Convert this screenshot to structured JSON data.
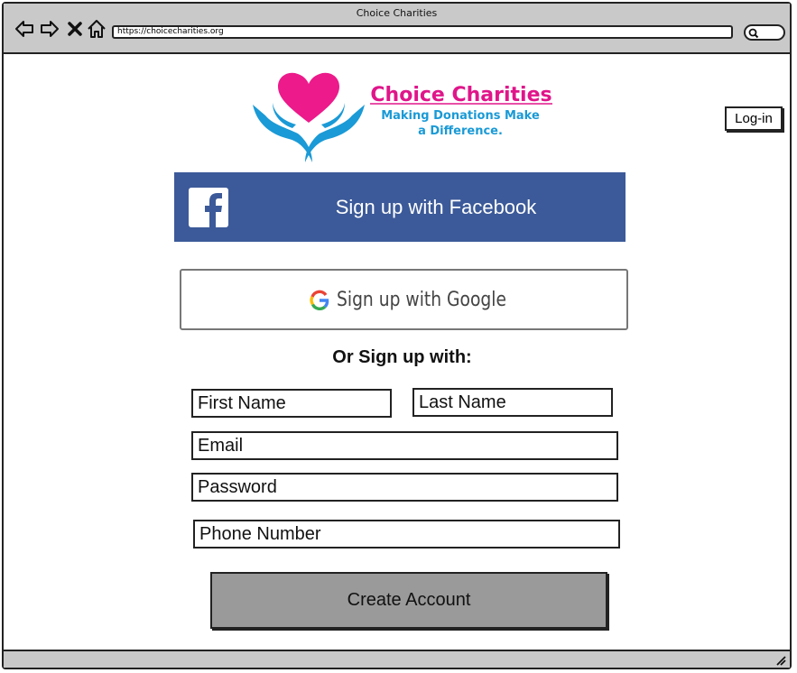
{
  "window": {
    "title": "Choice Charities"
  },
  "browser": {
    "url": "https://choicecharities.org",
    "icons": [
      "back-arrow-icon",
      "forward-arrow-icon",
      "close-x-icon",
      "home-icon",
      "search-icon",
      "resize-grip-icon"
    ]
  },
  "logo": {
    "name": "Choice Charities",
    "tagline_line1": "Making Donations Make",
    "tagline_line2": "a Difference.",
    "colors": {
      "heart": "#ec1a8b",
      "hands": "#1a9ad6",
      "name": "#e0158a",
      "tagline": "#1a9ad6"
    }
  },
  "header": {
    "login_label": "Log-in"
  },
  "social": {
    "facebook_label": "Sign up with Facebook",
    "facebook_color": "#3c5a99",
    "google_label": "Sign up with Google"
  },
  "form": {
    "divider_label": "Or Sign up with:",
    "first_name": "First Name",
    "last_name": "Last Name",
    "email": "Email",
    "password": "Password",
    "phone": "Phone Number",
    "submit_label": "Create Account"
  }
}
